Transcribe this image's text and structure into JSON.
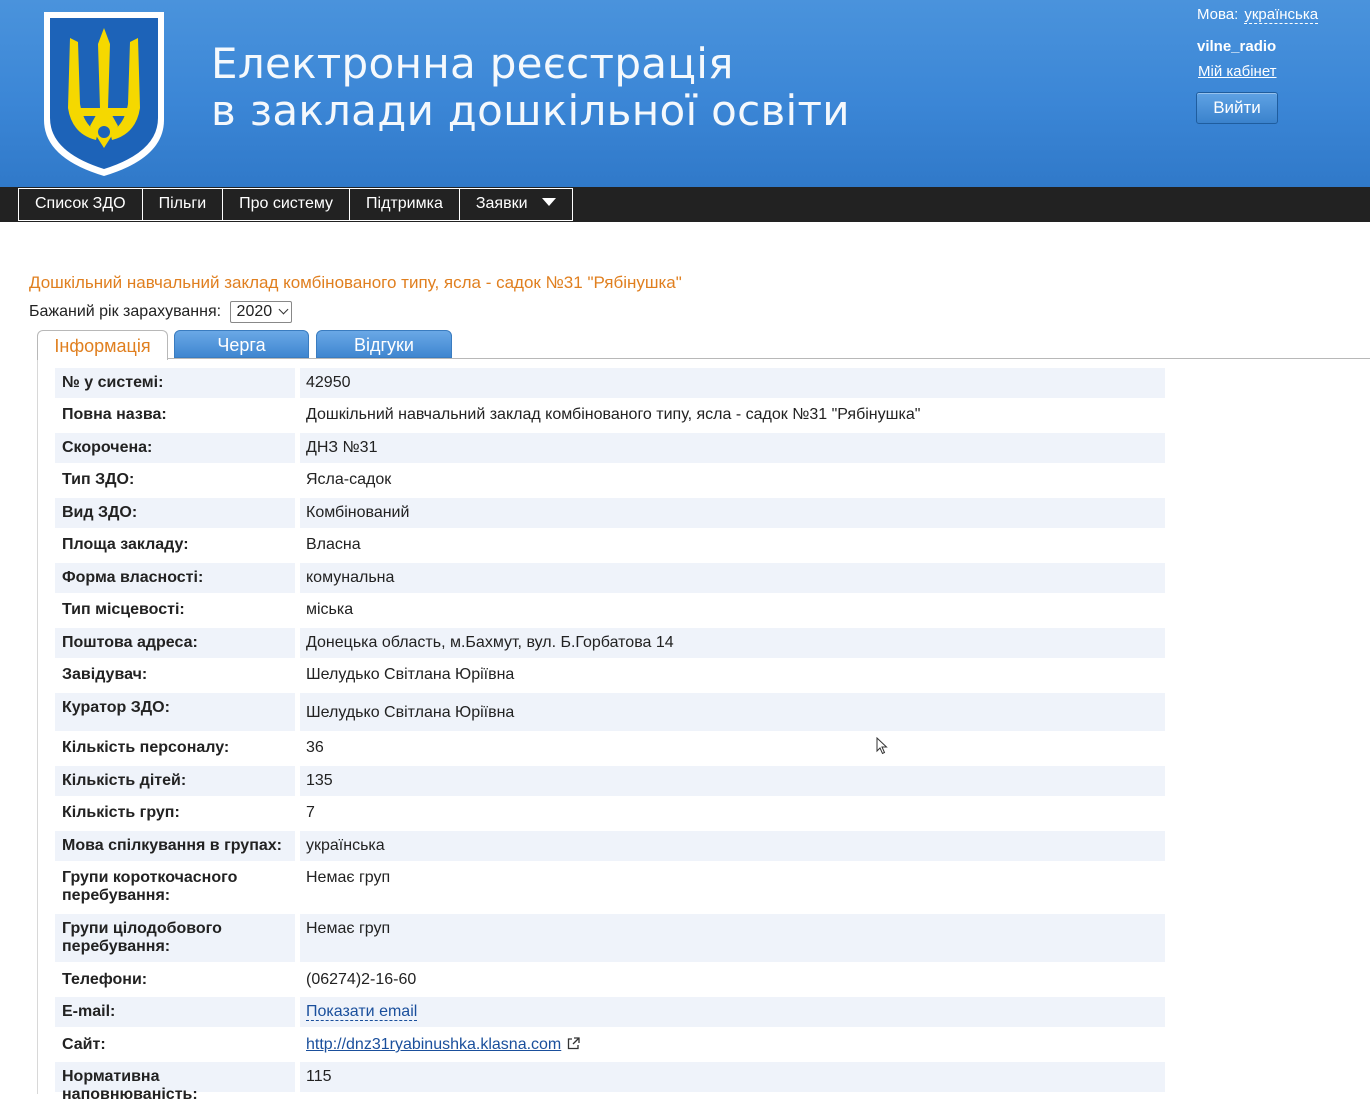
{
  "header": {
    "title_line1": "Електронна реєстрація",
    "title_line2": "в заклади дошкільної освіти",
    "language_label": "Мова:",
    "language_value": "українська",
    "username": "vilne_radio",
    "cabinet_link": "Мій кабінет",
    "logout_button": "Вийти"
  },
  "nav": {
    "items": [
      "Список ЗДО",
      "Пільги",
      "Про систему",
      "Підтримка",
      "Заявки"
    ]
  },
  "kindergarten": {
    "title": "Дошкільний навчальний заклад комбінованого типу, ясла - садок №31 \"Рябінушка\"",
    "year_label": "Бажаний рік зарахування:",
    "year_value": "2020"
  },
  "tabs": [
    "Інформація",
    "Черга",
    "Відгуки"
  ],
  "info": [
    {
      "label": "№ у системі:",
      "value": "42950"
    },
    {
      "label": "Повна назва:",
      "value": "Дошкільний навчальний заклад комбінованого типу, ясла - садок №31 \"Рябінушка\""
    },
    {
      "label": "Скорочена:",
      "value": "ДНЗ №31"
    },
    {
      "label": "Тип ЗДО:",
      "value": "Ясла-садок"
    },
    {
      "label": "Вид ЗДО:",
      "value": "Комбінований"
    },
    {
      "label": "Площа закладу:",
      "value": "Власна"
    },
    {
      "label": "Форма власності:",
      "value": "комунальна"
    },
    {
      "label": "Тип місцевості:",
      "value": "міська"
    },
    {
      "label": "Поштова адреса:",
      "value": "Донецька область, м.Бахмут, вул. Б.Горбатова 14"
    },
    {
      "label": "Завідувач:",
      "value": "Шелудько Світлана Юріївна"
    },
    {
      "label": "Куратор ЗДО:",
      "value": "Шелудько Світлана Юріївна"
    },
    {
      "label": "Кількість персоналу:",
      "value": "36"
    },
    {
      "label": "Кількість дітей:",
      "value": "135"
    },
    {
      "label": "Кількість груп:",
      "value": "7"
    },
    {
      "label": "Мова спілкування в групах:",
      "value": "українська"
    },
    {
      "label": "Групи короткочасного перебування:",
      "value": "Немає груп"
    },
    {
      "label": "Групи цілодобового перебування:",
      "value": "Немає груп"
    },
    {
      "label": "Телефони:",
      "value": "(06274)2-16-60"
    },
    {
      "label": "E-mail:",
      "value": "Показати email"
    },
    {
      "label": "Сайт:",
      "value": "http://dnz31ryabinushka.klasna.com"
    },
    {
      "label": "Нормативна наповнюваність:",
      "value": "115"
    }
  ]
}
